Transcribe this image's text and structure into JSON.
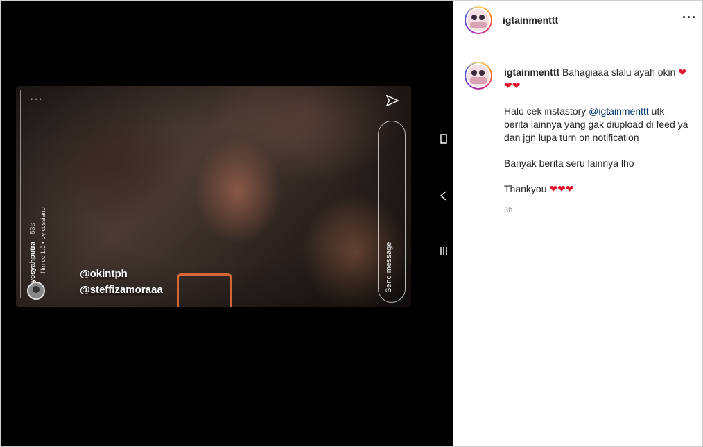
{
  "story": {
    "username": "mayosyahputra",
    "time": "53s",
    "music": "film cc 1.0 • by ccssiano",
    "mentions": [
      "@okintph",
      "@steffizamoraaa"
    ],
    "send_message": "Send message",
    "dots": "···"
  },
  "post": {
    "username": "igtainmenttt",
    "more": "···",
    "caption_user": "igtainmenttt",
    "caption_line1": "Bahagiaaa slalu ayah okin",
    "hearts": "❤❤❤",
    "para2_before": "Halo cek instastory ",
    "para2_link": "@igtainmenttt",
    "para2_after": " utk berita lainnya yang gak diupload di feed ya dan jgn lupa turn on notification",
    "para3": "Banyak berita seru lainnya lho",
    "para4": "Thankyou",
    "time": "3h"
  },
  "icons": [
    "send-icon",
    "more-icon",
    "heart-icon"
  ],
  "colors": {
    "link": "#00376b",
    "heart": "#e0152d"
  }
}
